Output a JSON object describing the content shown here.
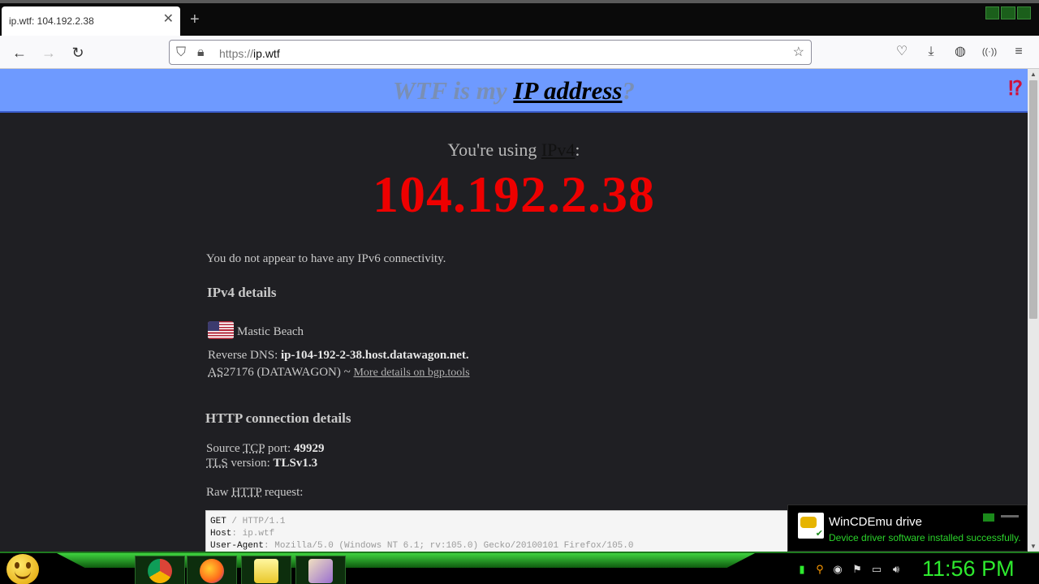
{
  "browser": {
    "tab_title": "ip.wtf: 104.192.2.38",
    "url_scheme": "https://",
    "url_host": "ip.wtf"
  },
  "header": {
    "title_prefix": "WTF is my",
    "title_link": "IP address",
    "title_suffix": "?",
    "corner_mark": "⁉"
  },
  "main": {
    "using_prefix": "You're using",
    "using_version": "IPv4",
    "using_suffix": ":",
    "ip": "104.192.2.38",
    "ipv6_note": "You do not appear to have any IPv6 connectivity.",
    "ipv4_heading": "IPv4 details",
    "location": "Mastic Beach",
    "rdns_label": "Reverse DNS:",
    "rdns_value": "ip-104-192-2-38.host.datawagon.net.",
    "as_abbr": "AS",
    "as_value": "27176 (DATAWAGON) ~",
    "as_link": "More details on bgp.tools",
    "http_heading": "HTTP connection details",
    "source_prefix": "Source",
    "tcp_abbr": "TCP",
    "port_label": "port:",
    "port_value": "49929",
    "tls_abbr": "TLS",
    "tls_label": "version:",
    "tls_value": "TLSv1.3",
    "raw_prefix": "Raw",
    "http_abbr": "HTTP",
    "raw_suffix": "request:",
    "raw_lines": {
      "l1_key": "GET",
      "l1_val": " / HTTP/1.1",
      "l2_key": "Host",
      "l2_val": ": ip.wtf",
      "l3_key": "User-Agent",
      "l3_val": ": Mozilla/5.0 (Windows NT 6.1; rv:105.0) Gecko/20100101 Firefox/105.0"
    }
  },
  "notification": {
    "title": "WinCDEmu drive",
    "message": "Device driver software installed successfully."
  },
  "taskbar": {
    "clock": "11:56 PM"
  }
}
